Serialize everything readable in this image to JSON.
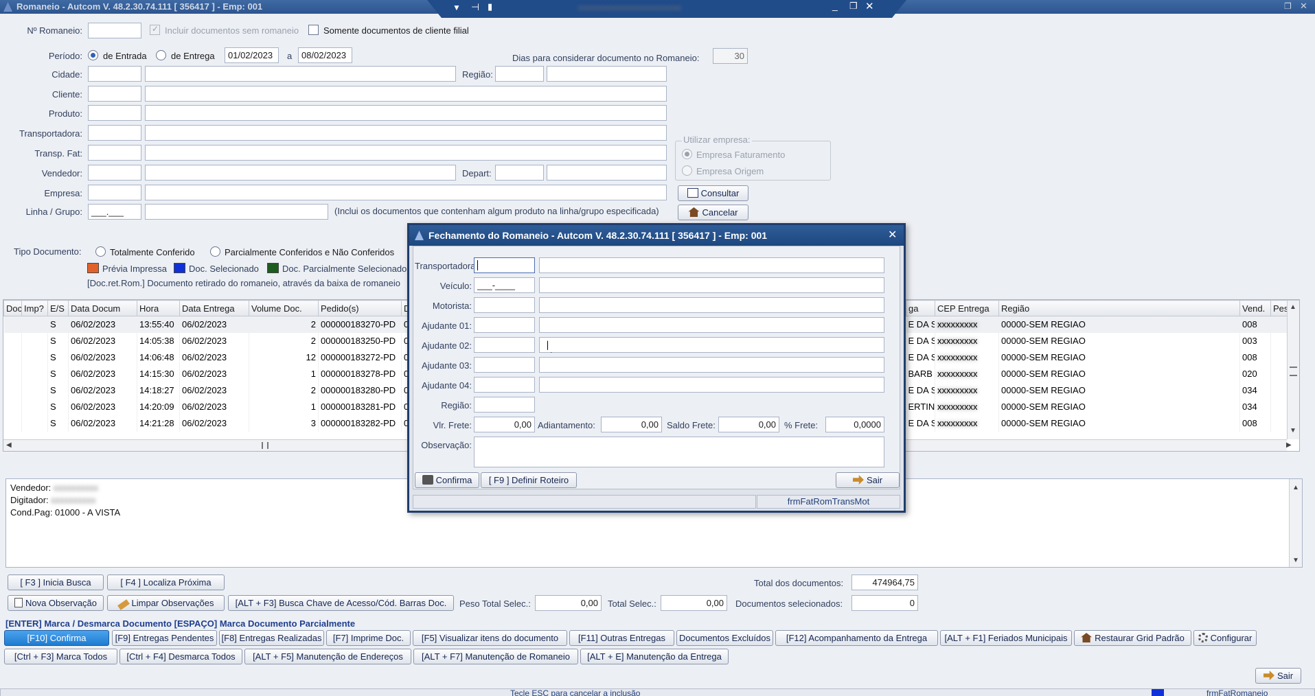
{
  "main": {
    "title": "Romaneio   -   Autcom V. 48.2.30.74.111 [ 356417 ] - Emp: 001",
    "form": {
      "romaneio_label": "Nº Romaneio:",
      "incluir_label": "Incluir documentos sem romaneio",
      "somente_label": "Somente documentos de cliente filial",
      "periodo_label": "Período:",
      "entrada_label": "de Entrada",
      "entrega_label": "de Entrega",
      "date_from": "01/02/2023",
      "a_label": "a",
      "date_to": "08/02/2023",
      "dias_label": "Dias para considerar documento no Romaneio:",
      "dias_value": "30",
      "cidade_label": "Cidade:",
      "regiao_label": "Região:",
      "cliente_label": "Cliente:",
      "produto_label": "Produto:",
      "transportadora_label": "Transportadora:",
      "transp_fat_label": "Transp. Fat:",
      "vendedor_label": "Vendedor:",
      "depart_label": "Depart:",
      "empresa_label": "Empresa:",
      "linha_label": "Linha / Grupo:",
      "linha_mask": "___.___",
      "linha_note": "(Inclui os documentos que contenham algum produto na linha/grupo especificada)",
      "utilizar_label": "Utilizar empresa:",
      "empresa_fat_label": "Empresa Faturamento",
      "empresa_orig_label": "Empresa Origem",
      "consultar_label": "Consultar",
      "cancelar_label": "Cancelar",
      "tipo_doc_label": "Tipo Documento:",
      "totalmente_label": "Totalmente Conferido",
      "parcial_label": "Parcialmente Conferidos e Não Conferidos",
      "legend_previa": "Prévia Impressa",
      "legend_selecionado": "Doc. Selecionado",
      "legend_parcial": "Doc. Parcialmente Selecionado",
      "doc_ret_note": "[Doc.ret.Rom.] Documento retirado do romaneio, através da baixa de romaneio"
    },
    "grid": {
      "left_columns": [
        "Doc",
        "Imp?",
        "E/S",
        "Data Docum",
        "Hora",
        "Data Entrega",
        "Volume Doc.",
        "Pedido(s)",
        "De"
      ],
      "right_columns": [
        "ga",
        "CEP Entrega",
        "Região",
        "Vend.",
        "Peso"
      ],
      "rows": [
        {
          "es": "S",
          "data": "06/02/2023",
          "hora": "13:55:40",
          "entrega": "06/02/2023",
          "volume": "2",
          "pedido": "000000183270-PD",
          "de": "00",
          "ga": "E DA S",
          "regiao": "00000-SEM REGIAO",
          "vend": "008"
        },
        {
          "es": "S",
          "data": "06/02/2023",
          "hora": "14:05:38",
          "entrega": "06/02/2023",
          "volume": "2",
          "pedido": "000000183250-PD",
          "de": "00",
          "ga": "E DA S",
          "regiao": "00000-SEM REGIAO",
          "vend": "003"
        },
        {
          "es": "S",
          "data": "06/02/2023",
          "hora": "14:06:48",
          "entrega": "06/02/2023",
          "volume": "12",
          "pedido": "000000183272-PD",
          "de": "00",
          "ga": "E DA S",
          "regiao": "00000-SEM REGIAO",
          "vend": "008"
        },
        {
          "es": "S",
          "data": "06/02/2023",
          "hora": "14:15:30",
          "entrega": "06/02/2023",
          "volume": "1",
          "pedido": "000000183278-PD",
          "de": "00",
          "ga": "BARB",
          "regiao": "00000-SEM REGIAO",
          "vend": "020"
        },
        {
          "es": "S",
          "data": "06/02/2023",
          "hora": "14:18:27",
          "entrega": "06/02/2023",
          "volume": "2",
          "pedido": "000000183280-PD",
          "de": "00",
          "ga": "E DA S",
          "regiao": "00000-SEM REGIAO",
          "vend": "034"
        },
        {
          "es": "S",
          "data": "06/02/2023",
          "hora": "14:20:09",
          "entrega": "06/02/2023",
          "volume": "1",
          "pedido": "000000183281-PD",
          "de": "00",
          "ga": "ERTIN",
          "regiao": "00000-SEM REGIAO",
          "vend": "034"
        },
        {
          "es": "S",
          "data": "06/02/2023",
          "hora": "14:21:28",
          "entrega": "06/02/2023",
          "volume": "3",
          "pedido": "000000183282-PD",
          "de": "00",
          "ga": "E DA S",
          "regiao": "00000-SEM REGIAO",
          "vend": "008"
        }
      ]
    },
    "memo": {
      "vendedor_label": "Vendedor:",
      "digitador_label": "Digitador:",
      "cond_pag": "Cond.Pag: 01000 - A VISTA"
    },
    "bottom": {
      "inicia_busca": "[ F3 ] Inicia Busca",
      "localiza_proxima": "[ F4 ] Localiza Próxima",
      "total_docs_label": "Total dos documentos:",
      "total_docs_value": "474964,75",
      "nova_obs": "Nova Observação",
      "limpar_obs": "Limpar Observações",
      "busca_chave": "[ALT + F3] Busca Chave de Acesso/Cód. Barras Doc.",
      "peso_label": "Peso Total Selec.:",
      "peso_value": "0,00",
      "total_selec_label": "Total Selec.:",
      "total_selec_value": "0,00",
      "docs_selec_label": "Documentos selecionados:",
      "docs_selec_value": "0",
      "hint": "[ENTER] Marca / Desmarca Documento  [ESPAÇO] Marca Documento Parcialmente",
      "actions_row1": [
        "[F10] Confirma",
        "[F9] Entregas Pendentes",
        "[F8] Entregas Realizadas",
        "[F7] Imprime Doc.",
        "[F5] Visualizar itens do documento",
        "[F11] Outras Entregas",
        "Documentos Excluídos",
        "[F12] Acompanhamento da Entrega",
        "[ALT + F1] Feriados Municipais",
        "Restaurar Grid Padrão",
        "Configurar"
      ],
      "actions_row2": [
        "[Ctrl + F3] Marca Todos",
        "[Ctrl + F4] Desmarca Todos",
        "[ALT + F5] Manutenção de Endereços",
        "[ALT + F7] Manutenção de Romaneio",
        "[ALT + E] Manutenção da Entrega"
      ],
      "sair": "Sair",
      "status_text": "Tecle ESC para cancelar a inclusão",
      "form_name": "frmFatRomaneio"
    }
  },
  "dialog": {
    "title": "Fechamento do Romaneio   -   Autcom V. 48.2.30.74.111 [ 356417 ] - Emp: 001",
    "transportadora_label": "Transportadora:",
    "veiculo_label": "Veículo:",
    "veiculo_mask": "___-____",
    "motorista_label": "Motorista:",
    "ajudante1_label": "Ajudante 01:",
    "ajudante2_label": "Ajudante 02:",
    "ajudante3_label": "Ajudante 03:",
    "ajudante4_label": "Ajudante 04:",
    "regiao_label": "Região:",
    "vlr_frete_label": "Vlr. Frete:",
    "vlr_frete_value": "0,00",
    "adiantamento_label": "Adiantamento:",
    "adiantamento_value": "0,00",
    "saldo_frete_label": "Saldo Frete:",
    "saldo_frete_value": "0,00",
    "pct_frete_label": "% Frete:",
    "pct_frete_value": "0,0000",
    "observacao_label": "Observação:",
    "confirma_label": "Confirma",
    "definir_roteiro_label": "[ F9 ] Definir Roteiro",
    "sair_label": "Sair",
    "form_name": "frmFatRomTransMot"
  },
  "colors": {
    "titlebar": "#2d5590",
    "previa": "#e0622a",
    "selecionado": "#1030d8",
    "parcial": "#1e5b20",
    "confirm_btn": "#2f8fe0"
  }
}
